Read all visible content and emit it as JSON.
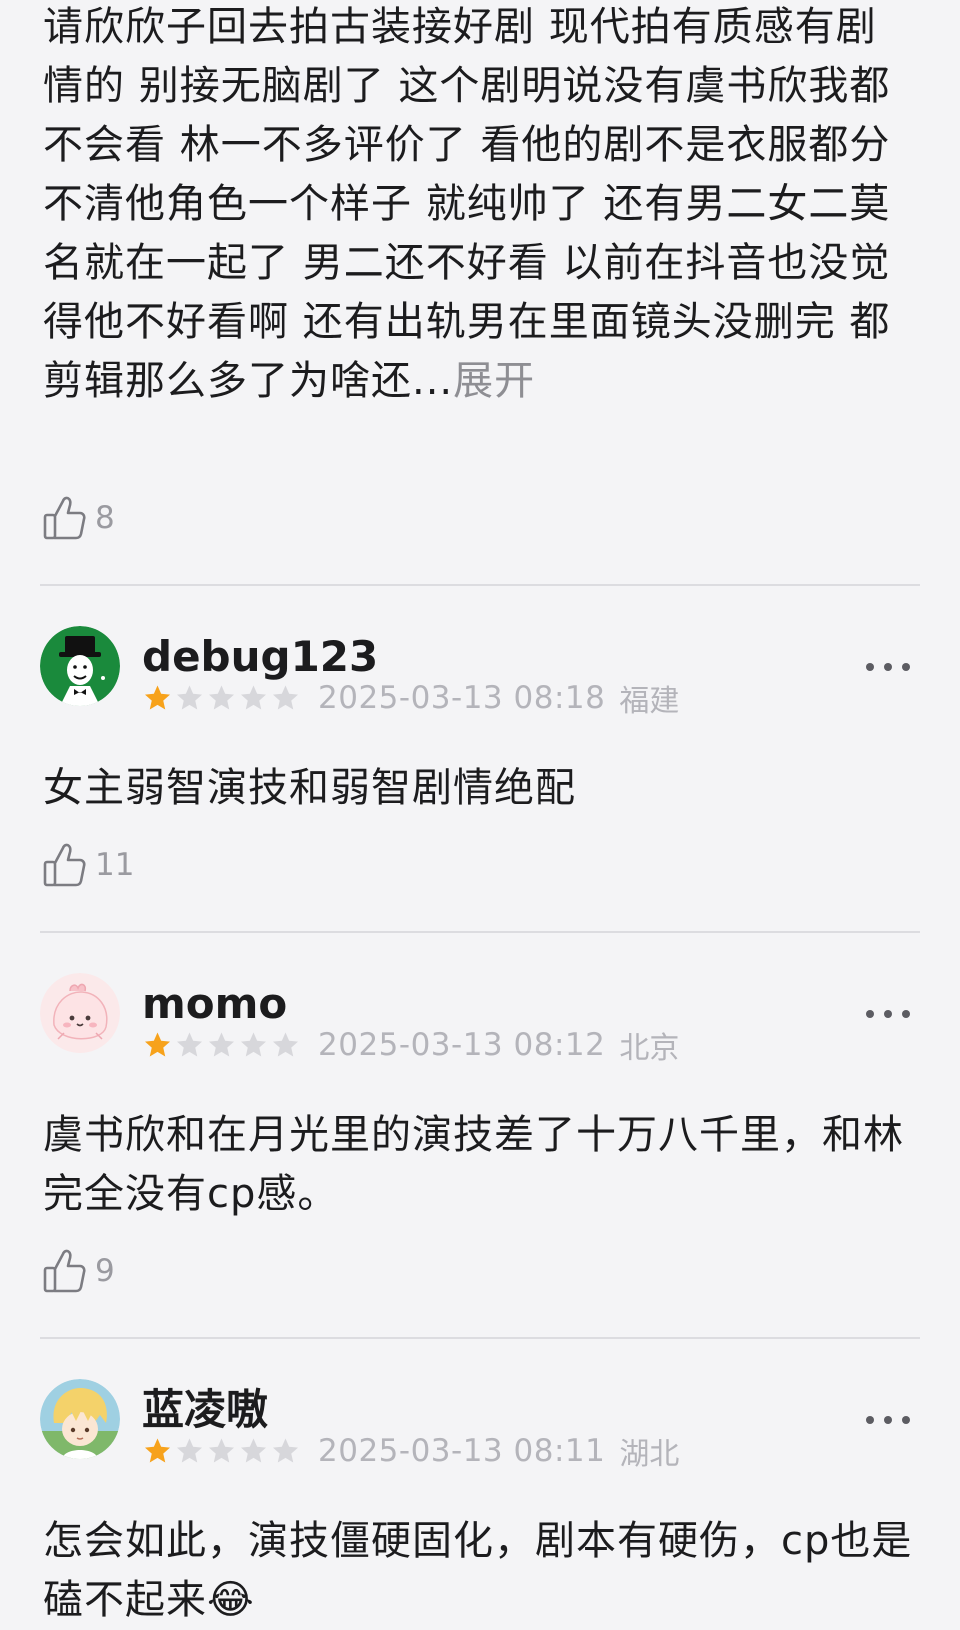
{
  "colors": {
    "background": "#f4f4f6",
    "text": "#1c1c1e",
    "muted": "#9a9aa0",
    "meta": "#b4b4ba",
    "star_filled": "#f7a21b",
    "star_empty": "#d7d7db",
    "divider": "#dcdce0"
  },
  "reviews": [
    {
      "text": "请欣欣子回去拍古装接好剧 现代拍有质感有剧情的 别接无脑剧了 这个剧明说没有虞书欣我都不会看 林一不多评价了 看他的剧不是衣服都分不清他角色一个样子 就纯帅了 还有男二女二莫名就在一起了 男二还不好看 以前在抖音也没觉得他不好看啊 还有出轨男在里面镜头没删完 都剪辑那么多了为啥还...",
      "expand_label": "展开",
      "likes": "8",
      "like_icon": "thumbs-up-icon"
    },
    {
      "username": "debug123",
      "avatar_icon": "top-hat-gentleman-avatar",
      "rating": 1,
      "rating_max": 5,
      "date": "2025-03-13 08:18",
      "region": "福建",
      "text": "女主弱智演技和弱智剧情绝配",
      "likes": "11",
      "more_icon": "more-dots-icon"
    },
    {
      "username": "momo",
      "avatar_icon": "pink-blob-avatar",
      "rating": 1,
      "rating_max": 5,
      "date": "2025-03-13 08:12",
      "region": "北京",
      "text": "虞书欣和在月光里的演技差了十万八千里，和林完全没有cp感。",
      "likes": "9",
      "more_icon": "more-dots-icon"
    },
    {
      "username": "蓝凌嗷",
      "avatar_icon": "anime-boy-avatar",
      "rating": 1,
      "rating_max": 5,
      "date": "2025-03-13 08:11",
      "region": "湖北",
      "text": "怎会如此，演技僵硬固化，剧本有硬伤，cp也是磕不起来😂",
      "more_icon": "more-dots-icon"
    }
  ]
}
